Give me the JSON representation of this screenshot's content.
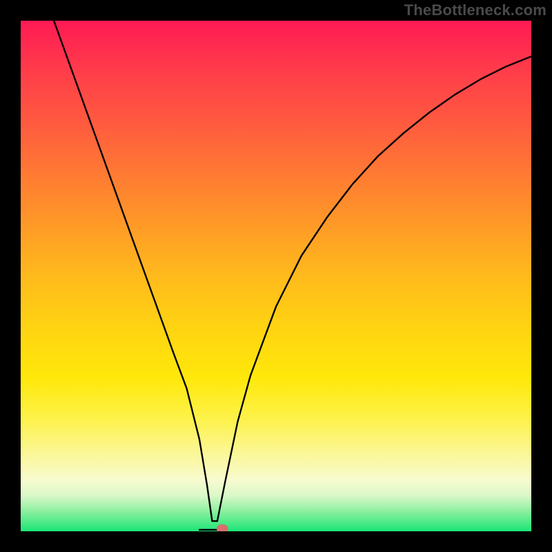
{
  "watermark": "TheBottleneck.com",
  "chart_data": {
    "type": "line",
    "title": "",
    "xlabel": "",
    "ylabel": "",
    "xlim": [
      0,
      1
    ],
    "ylim": [
      0,
      1
    ],
    "series": [
      {
        "name": "curve",
        "x": [
          0.065,
          0.1,
          0.15,
          0.2,
          0.25,
          0.3,
          0.325,
          0.35,
          0.365,
          0.375,
          0.385,
          0.4,
          0.425,
          0.45,
          0.5,
          0.55,
          0.6,
          0.65,
          0.7,
          0.75,
          0.8,
          0.85,
          0.9,
          0.95,
          1.0
        ],
        "y": [
          1.0,
          0.903,
          0.764,
          0.625,
          0.486,
          0.347,
          0.28,
          0.18,
          0.09,
          0.02,
          0.02,
          0.095,
          0.215,
          0.305,
          0.44,
          0.54,
          0.615,
          0.68,
          0.735,
          0.78,
          0.82,
          0.855,
          0.885,
          0.91,
          0.93
        ]
      }
    ],
    "flat_segment": {
      "x0": 0.35,
      "x1": 0.39,
      "y": 0.003
    },
    "marker": {
      "x": 0.395,
      "y": 0.005
    },
    "gradient_stops": [
      {
        "pos": 0.0,
        "color": "#ff1a54"
      },
      {
        "pos": 0.5,
        "color": "#ffba1c"
      },
      {
        "pos": 0.78,
        "color": "#fdf24a"
      },
      {
        "pos": 1.0,
        "color": "#1be576"
      }
    ]
  }
}
